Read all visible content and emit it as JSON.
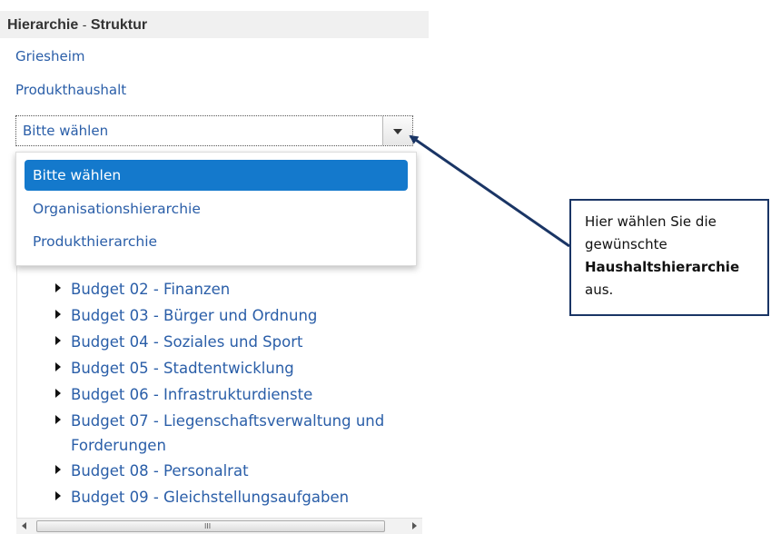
{
  "header": {
    "title": "Hierarchie",
    "separator": "-",
    "subtitle": "Struktur"
  },
  "links": [
    "Griesheim",
    "Produkthaushalt"
  ],
  "select": {
    "value": "Bitte wählen"
  },
  "dropdown": {
    "options": [
      {
        "label": "Bitte wählen",
        "selected": true
      },
      {
        "label": "Organisationshierarchie",
        "selected": false
      },
      {
        "label": "Produkthierarchie",
        "selected": false
      }
    ]
  },
  "tree": {
    "items": [
      {
        "label": "Budget 02 - Finanzen"
      },
      {
        "label": "Budget 03 - Bürger und Ordnung"
      },
      {
        "label": "Budget 04 - Soziales und Sport"
      },
      {
        "label": "Budget 05 - Stadtentwicklung"
      },
      {
        "label": "Budget 06 - Infrastrukturdienste"
      },
      {
        "label": "Budget 07 - Liegenschaftsverwaltung und",
        "continuation": "Forderungen"
      },
      {
        "label": "Budget 08 - Personalrat"
      },
      {
        "label": "Budget 09 - Gleichstellungsaufgaben"
      }
    ]
  },
  "scrollbar": {
    "grip": "III"
  },
  "callout": {
    "line1": "Hier wählen Sie die",
    "line2": "gewünschte",
    "line3_bold": "Haushaltshierarchie",
    "line4": "aus."
  },
  "colors": {
    "link": "#2a5ea8",
    "selected_option": "#1479cc",
    "callout_border": "#1a3565"
  }
}
